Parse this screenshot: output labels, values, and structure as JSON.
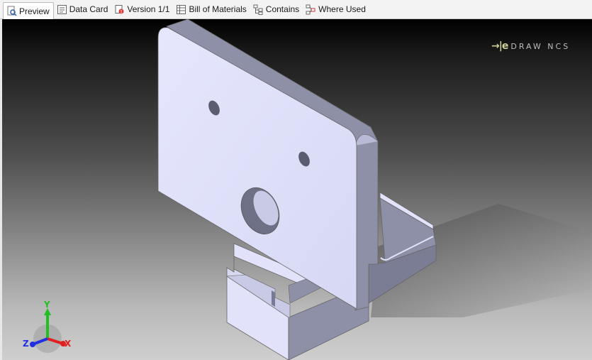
{
  "tabs": [
    {
      "label": "Preview",
      "icon": "preview-icon",
      "active": true
    },
    {
      "label": "Data Card",
      "icon": "data-card-icon",
      "active": false
    },
    {
      "label": "Version 1/1",
      "icon": "version-icon",
      "active": false
    },
    {
      "label": "Bill of Materials",
      "icon": "bill-of-materials-icon",
      "active": false
    },
    {
      "label": "Contains",
      "icon": "contains-icon",
      "active": false
    },
    {
      "label": "Where Used",
      "icon": "where-used-icon",
      "active": false
    }
  ],
  "watermark": {
    "mark": "→|e",
    "text": "DRAW NCS"
  },
  "triad": {
    "x": "X",
    "y": "Y",
    "z": "Z"
  },
  "colors": {
    "part_face": "#e2e3fb",
    "part_side": "#8d90a6",
    "axis_x": "#e02020",
    "axis_y": "#20c020",
    "axis_z": "#2030e0"
  }
}
